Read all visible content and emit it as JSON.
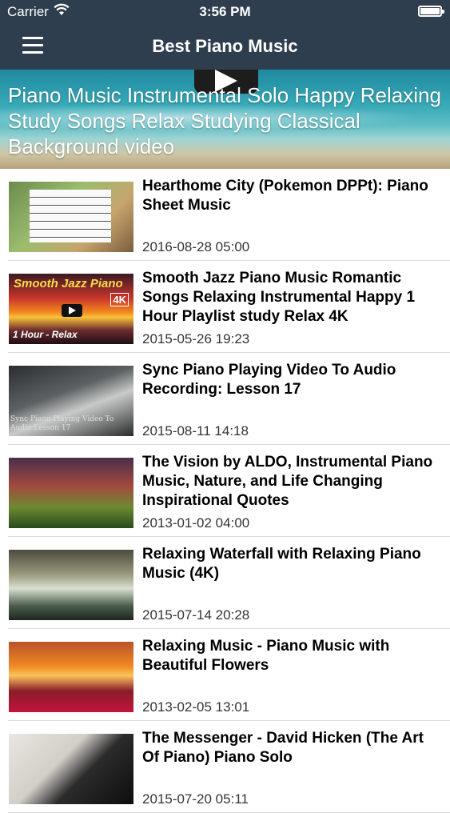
{
  "status": {
    "carrier": "Carrier",
    "time": "3:56 PM"
  },
  "nav": {
    "title": "Best Piano Music"
  },
  "featured": {
    "title": "Piano Music Instrumental Solo Happy Relaxing Study Songs Relax Studying Classical Background video"
  },
  "videos": [
    {
      "title": "Hearthome City (Pokemon DPPt): Piano Sheet Music",
      "date": "2016-08-28 05:00"
    },
    {
      "title": "Smooth Jazz Piano Music Romantic Songs Relaxing Instrumental Happy 1 Hour Playlist study Relax 4K",
      "date": "2015-05-26 19:23",
      "thumb_text": {
        "top": "Smooth Jazz Piano",
        "badge": "4K",
        "bottom": "1 Hour - Relax"
      }
    },
    {
      "title": "Sync Piano Playing Video To Audio Recording: Lesson 17",
      "date": "2015-08-11 14:18",
      "thumb_text": {
        "caption": "Sync Piano Playing Video To Audio Lesson 17"
      }
    },
    {
      "title": "The Vision by ALDO, Instrumental Piano Music, Nature, and Life Changing Inspirational Quotes",
      "date": "2013-01-02 04:00"
    },
    {
      "title": "Relaxing Waterfall with Relaxing Piano Music (4K)",
      "date": "2015-07-14 20:28"
    },
    {
      "title": "Relaxing Music - Piano Music with Beautiful Flowers",
      "date": "2013-02-05 13:01"
    },
    {
      "title": "The Messenger - David Hicken (The Art Of Piano) Piano Solo",
      "date": "2015-07-20 05:11"
    }
  ],
  "colors": {
    "navbar": "#2f3e4f",
    "separator": "#dcdcdc"
  },
  "icons": {
    "menu": "hamburger-menu-icon",
    "wifi": "wifi-icon",
    "battery": "battery-icon",
    "play": "play-icon"
  }
}
